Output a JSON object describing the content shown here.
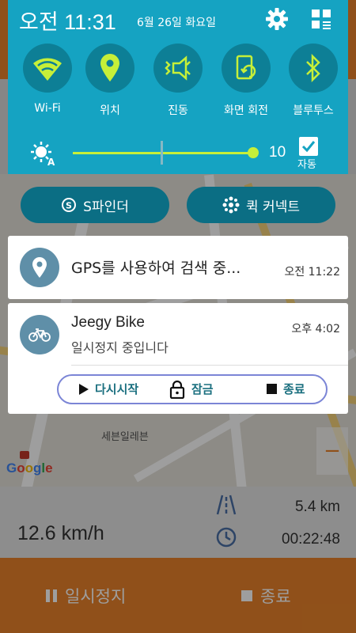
{
  "status_bar": {
    "time": "오전 11:31",
    "date": "6월 26일 화요일",
    "settings_icon": "gear-icon",
    "edit_icon": "grid-edit-icon"
  },
  "quick_settings": [
    {
      "label": "Wi-Fi",
      "icon": "wifi-icon"
    },
    {
      "label": "위치",
      "icon": "location-icon"
    },
    {
      "label": "진동",
      "icon": "vibrate-icon"
    },
    {
      "label": "화면 회전",
      "icon": "rotate-icon"
    },
    {
      "label": "블루투스",
      "icon": "bluetooth-icon"
    }
  ],
  "brightness": {
    "value": "10",
    "level_fraction": 0.98,
    "auto_label": "자동",
    "auto_checked": true
  },
  "shortcuts": {
    "s_finder": "S파인더",
    "quick_connect": "퀵 커넥트"
  },
  "notifications": {
    "gps": {
      "title": "GPS를 사용하여 검색 중...",
      "time": "오전 11:22"
    },
    "app": {
      "title": "Jeegy Bike",
      "subtitle": "일시정지 중입니다",
      "time": "오후 4:02",
      "actions": {
        "resume": "다시시작",
        "lock": "잠금",
        "stop": "종료"
      }
    }
  },
  "background_app": {
    "map_label": "세븐일레븐",
    "google": [
      "G",
      "o",
      "o",
      "g",
      "l",
      "e"
    ],
    "speed": "12.6 km/h",
    "distance": "5.4 km",
    "elapsed": "00:22:48",
    "pause_label": "일시정지",
    "stop_label": "종료"
  },
  "colors": {
    "shade": "#15a3c2",
    "accent_lime": "#c6ef39",
    "app_orange": "#e8822a",
    "action_border": "#7b85d6"
  }
}
